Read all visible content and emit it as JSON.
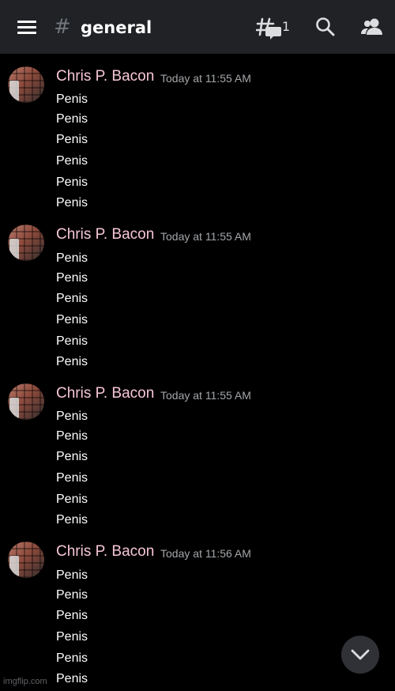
{
  "header": {
    "menu_icon": "hamburger-icon",
    "channel_prefix": "#",
    "channel_name": "general",
    "threads_icon": "threads-icon",
    "threads_count": "1",
    "search_icon": "search-icon",
    "members_icon": "members-icon"
  },
  "messages": [
    {
      "author": "Chris P. Bacon",
      "timestamp": "Today at 11:55 AM",
      "lines": [
        "Penis",
        "Penis",
        "Penis",
        "Penis",
        "Penis",
        "Penis"
      ]
    },
    {
      "author": "Chris P. Bacon",
      "timestamp": "Today at 11:55 AM",
      "lines": [
        "Penis",
        "Penis",
        "Penis",
        "Penis",
        "Penis",
        "Penis"
      ]
    },
    {
      "author": "Chris P. Bacon",
      "timestamp": "Today at 11:55 AM",
      "lines": [
        "Penis",
        "Penis",
        "Penis",
        "Penis",
        "Penis",
        "Penis"
      ]
    },
    {
      "author": "Chris P. Bacon",
      "timestamp": "Today at 11:56 AM",
      "lines": [
        "Penis",
        "Penis",
        "Penis",
        "Penis",
        "Penis",
        "Penis"
      ]
    }
  ],
  "scroll_button_icon": "chevron-down-icon",
  "watermark": "imgflip.com",
  "colors": {
    "background": "#000000",
    "header": "#202225",
    "author_name": "#f7c6d8",
    "timestamp": "#a3a6aa"
  }
}
